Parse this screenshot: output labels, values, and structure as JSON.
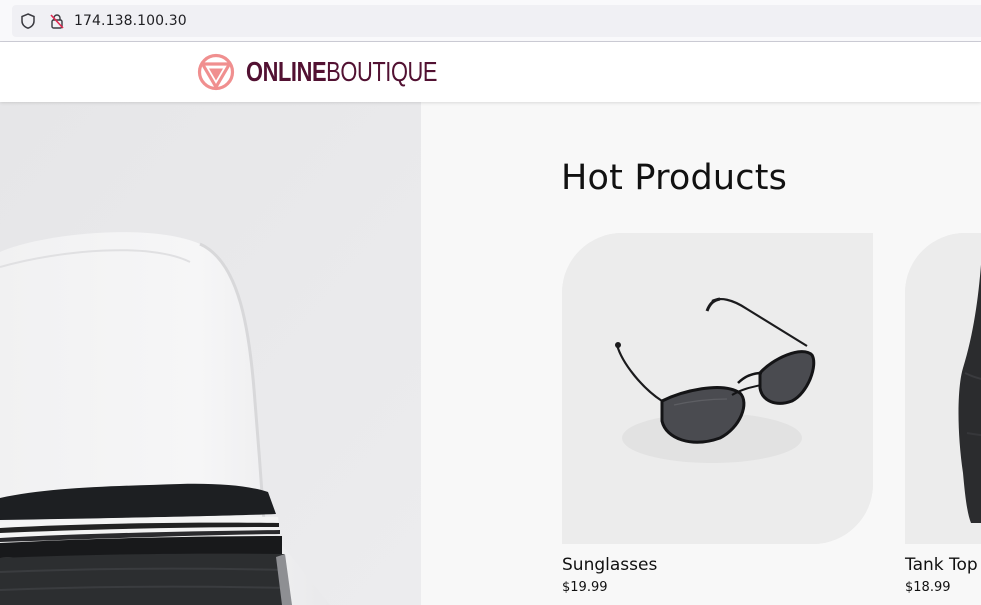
{
  "browser": {
    "url": "174.138.100.30",
    "icons": [
      "shield-icon",
      "lock-icon"
    ]
  },
  "header": {
    "logo_bold": "ONLINE",
    "logo_light": "BOUTIQUE",
    "logo_icon": "boutique-logo-icon",
    "brand_color": "#521132",
    "logo_accent": "#f08f8f"
  },
  "main": {
    "section_title": "Hot Products",
    "products": [
      {
        "name": "Sunglasses",
        "price": "$19.99",
        "image": "sunglasses-image"
      },
      {
        "name": "Tank Top",
        "price": "$18.99",
        "image": "tank-top-image"
      }
    ]
  }
}
